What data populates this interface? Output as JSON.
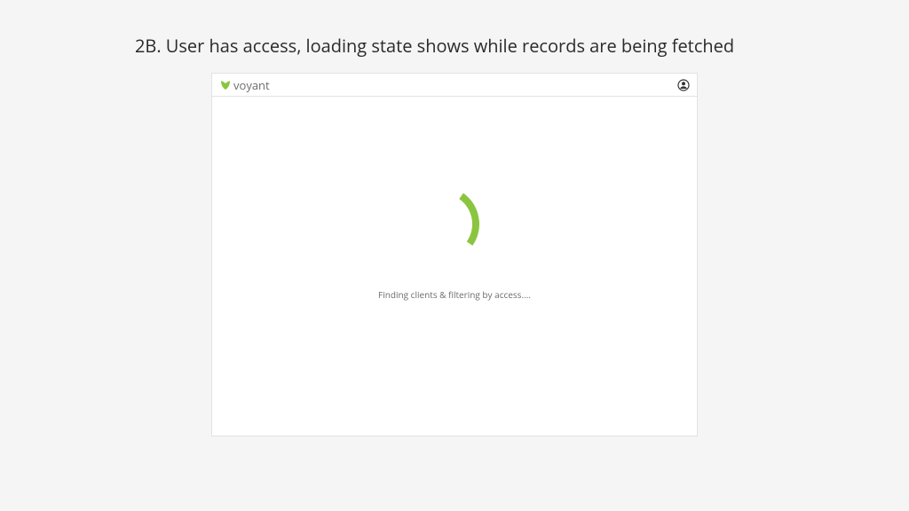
{
  "caption": "2B. User has access, loading state shows while records are being fetched",
  "brand": {
    "name": "voyant"
  },
  "loading": {
    "message": "Finding clients & filtering by access...."
  },
  "colors": {
    "accent": "#8bc540"
  }
}
